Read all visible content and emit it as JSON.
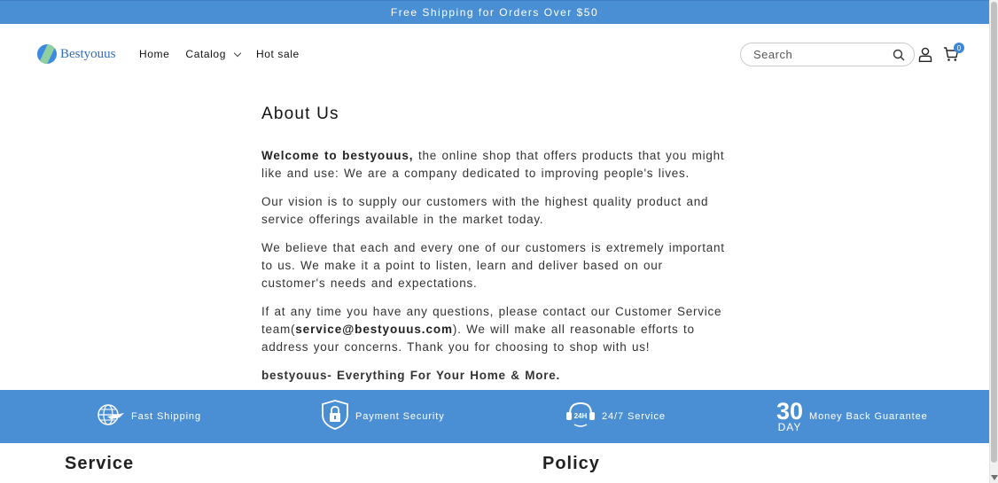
{
  "announcement": {
    "text": "Free Shipping for Orders Over $50"
  },
  "header": {
    "logo_text": "Bestyouus",
    "nav": [
      {
        "label": "Home"
      },
      {
        "label": "Catalog"
      },
      {
        "label": "Hot sale"
      }
    ],
    "search": {
      "placeholder": "Search"
    },
    "cart_count": "0"
  },
  "main": {
    "title": "About Us",
    "p1_strong": "Welcome to bestyouus,",
    "p1_text": " the online shop that offers products that you might like and use: We are a company dedicated to improving people's lives.",
    "p2": "Our vision is to supply our customers with the highest quality product and service offerings available in the market today.",
    "p3": "We believe that each and every one of our customers is extremely important to us. We make it a point to listen, learn and deliver based on our customer's needs and expectations.",
    "p4_before": "If at any time you have any questions, please contact our Customer Service team(",
    "p4_email": "service@bestyouus.com",
    "p4_after": "). We will make all reasonable efforts to address your concerns. Thank you for choosing to shop with us!",
    "tagline": "bestyouus- Everything For Your Home & More."
  },
  "features": [
    {
      "icon": "globe-plane-icon",
      "label": "Fast Shipping"
    },
    {
      "icon": "lock-shield-icon",
      "label": "Payment Security"
    },
    {
      "icon": "24h-support-icon",
      "label": "24/7 Service"
    },
    {
      "icon": "30-day-icon",
      "number": "30",
      "unit": "DAY",
      "label": "Money Back Guarantee"
    }
  ],
  "footer": {
    "col1_title": "Service",
    "col2_title": "Policy"
  },
  "colors": {
    "accent": "#4a8fd4",
    "text": "#121212",
    "white": "#ffffff"
  }
}
